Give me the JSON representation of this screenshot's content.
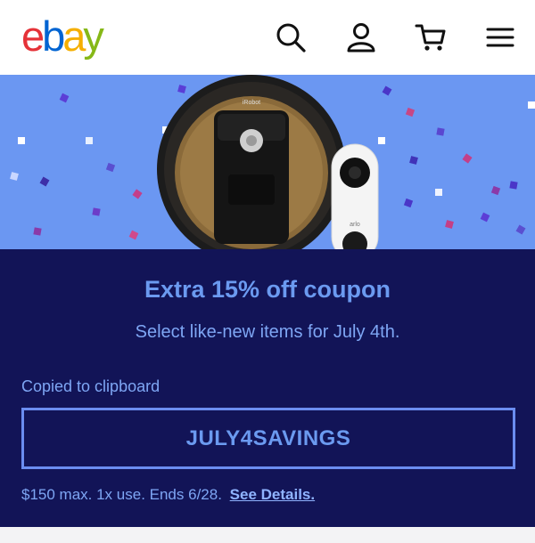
{
  "header": {
    "logo_letters": [
      {
        "char": "e",
        "color": "#e53238"
      },
      {
        "char": "b",
        "color": "#0064d2"
      },
      {
        "char": "a",
        "color": "#f5af02"
      },
      {
        "char": "y",
        "color": "#86b817"
      }
    ],
    "icons": [
      "search-icon",
      "account-icon",
      "cart-icon",
      "menu-icon"
    ]
  },
  "hero": {
    "background": "#6b97f2",
    "products": [
      "robot-vacuum-image",
      "video-doorbell-image"
    ],
    "vacuum_label": "iRobot",
    "doorbell_label": "arlo"
  },
  "coupon": {
    "title": "Extra 15% off coupon",
    "subtitle": "Select like-new items for July 4th.",
    "copied_text": "Copied to clipboard",
    "code": "JULY4SAVINGS",
    "terms": "$150 max. 1x use. Ends 6/28.",
    "details_link": "See Details.",
    "panel_color": "#121457",
    "accent_color": "#6b9af0"
  }
}
